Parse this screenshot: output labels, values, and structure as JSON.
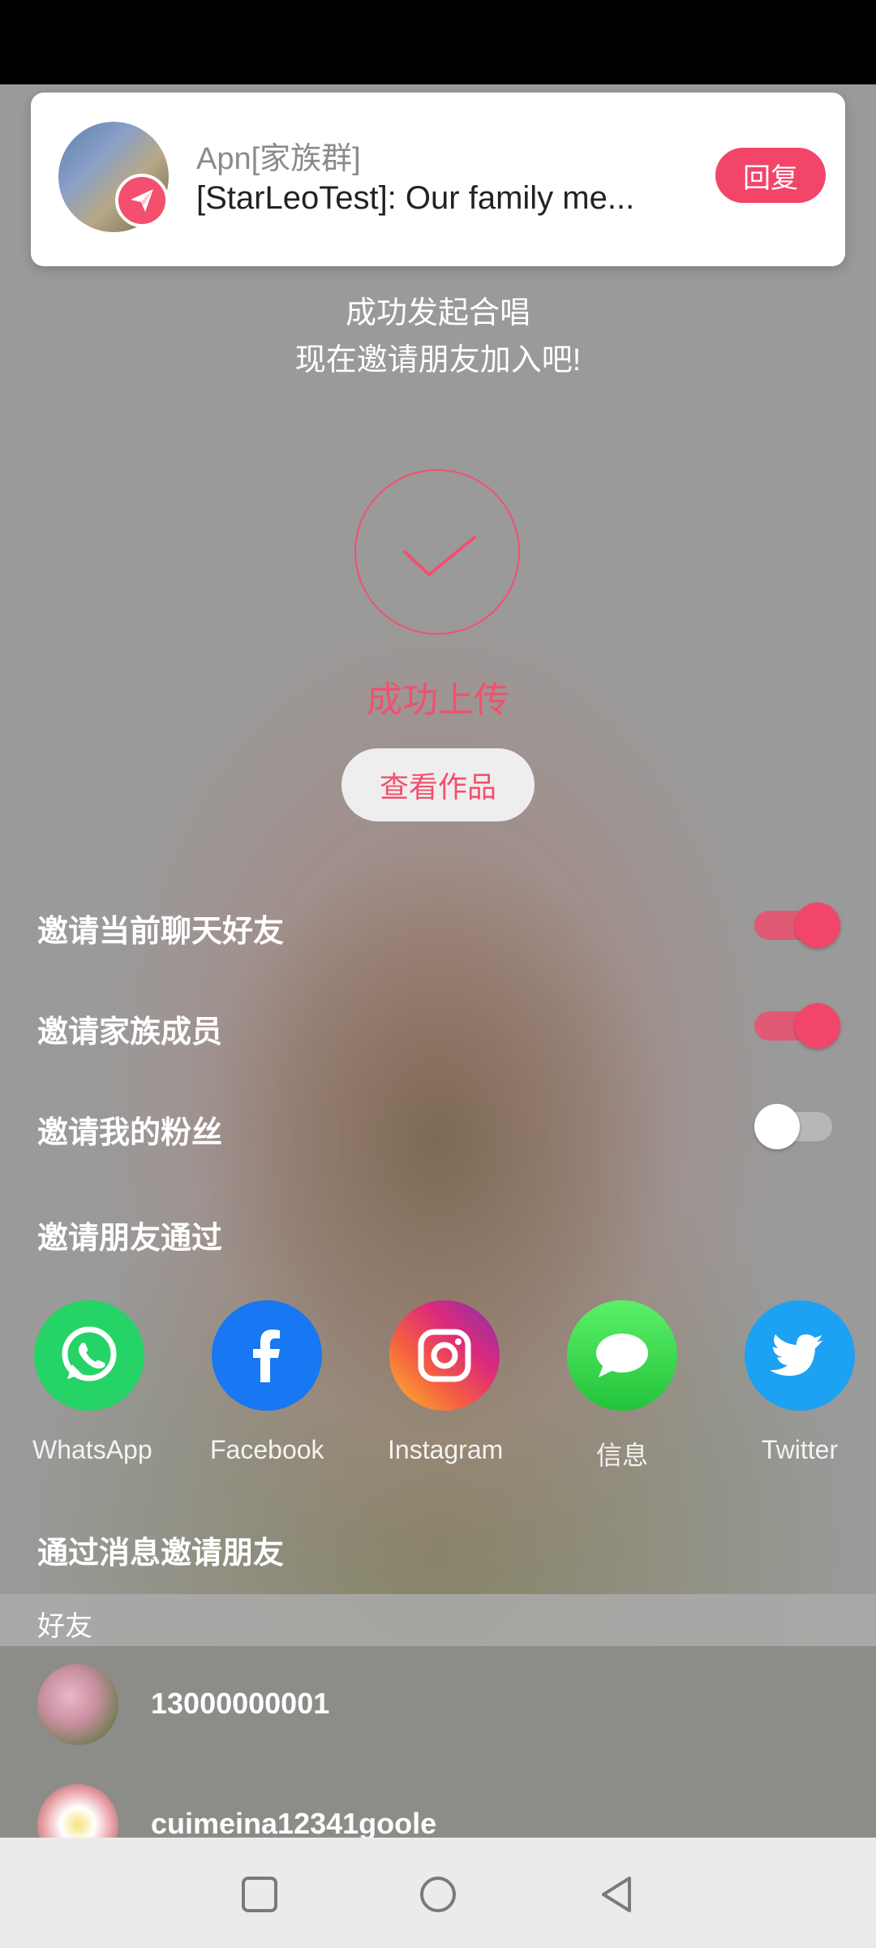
{
  "notification": {
    "title": "Apn[家族群]",
    "message": "[StarLeoTest]: Our family me...",
    "reply_label": "回复"
  },
  "header": {
    "subtitle_line1": "成功发起合唱",
    "subtitle_line2": "现在邀请朋友加入吧!"
  },
  "upload": {
    "status_label": "成功上传",
    "view_button_label": "查看作品"
  },
  "invite_options": [
    {
      "label": "邀请当前聊天好友",
      "enabled": true
    },
    {
      "label": "邀请家族成员",
      "enabled": true
    },
    {
      "label": "邀请我的粉丝",
      "enabled": false
    }
  ],
  "invite_via": {
    "heading": "邀请朋友通过",
    "apps": [
      {
        "label": "WhatsApp",
        "icon": "whatsapp-icon",
        "color": "#25d366"
      },
      {
        "label": "Facebook",
        "icon": "facebook-icon",
        "color": "#1877f2"
      },
      {
        "label": "Instagram",
        "icon": "instagram-icon",
        "color": "#dd2a7b"
      },
      {
        "label": "信息",
        "icon": "message-icon",
        "color": "#3bd44b"
      },
      {
        "label": "Twitter",
        "icon": "twitter-icon",
        "color": "#1da1f2"
      }
    ]
  },
  "invite_by_message": {
    "heading": "通过消息邀请朋友",
    "section_label": "好友",
    "friends": [
      {
        "name": "13000000001"
      },
      {
        "name": "cuimeina12341goole"
      }
    ]
  },
  "colors": {
    "accent": "#f3456a"
  }
}
